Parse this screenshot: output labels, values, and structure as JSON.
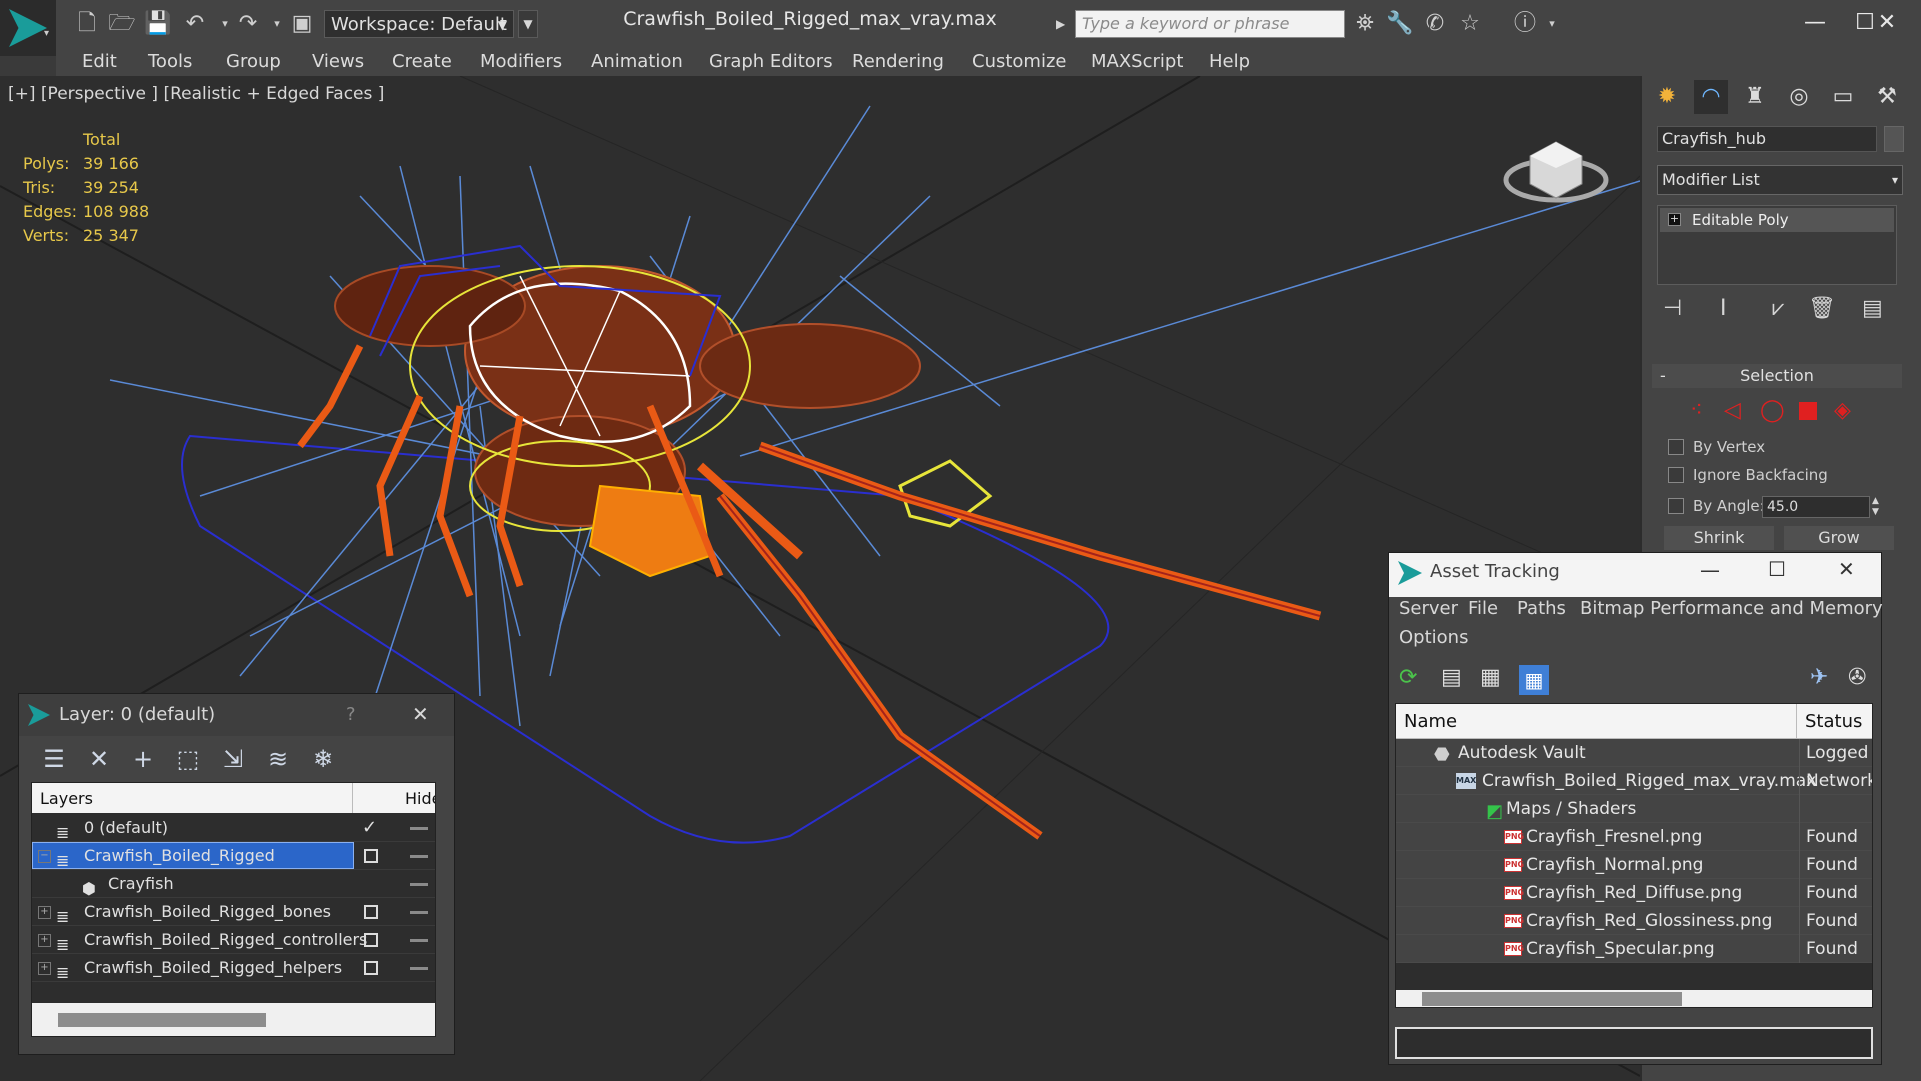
{
  "app": {
    "file_title": "Crawfish_Boiled_Rigged_max_vray.max",
    "workspace": "Workspace: Default",
    "search_placeholder": "Type a keyword or phrase"
  },
  "menu": [
    "Edit",
    "Tools",
    "Group",
    "Views",
    "Create",
    "Modifiers",
    "Animation",
    "Graph Editors",
    "Rendering",
    "Customize",
    "MAXScript",
    "Help"
  ],
  "viewport": {
    "label": "[+] [Perspective ] [Realistic + Edged Faces ]",
    "stats_header": "Total",
    "stats": [
      {
        "label": "Polys:",
        "value": "39 166"
      },
      {
        "label": "Tris:",
        "value": "39 254"
      },
      {
        "label": "Edges:",
        "value": "108 988"
      },
      {
        "label": "Verts:",
        "value": "25 347"
      }
    ]
  },
  "command_panel": {
    "object_name": "Crayfish_hub",
    "modifier_list": "Modifier List",
    "stack_item": "Editable Poly",
    "selection_title": "Selection",
    "selection_minus": "-",
    "by_vertex": "By Vertex",
    "ignore_backfacing": "Ignore Backfacing",
    "by_angle": "By Angle:",
    "angle_value": "45.0",
    "shrink": "Shrink",
    "grow": "Grow"
  },
  "layer_window": {
    "title": "Layer: 0 (default)",
    "help": "?",
    "close": "✕",
    "col_layers": "Layers",
    "col_hide": "Hide",
    "rows": [
      {
        "name": "0 (default)",
        "expander": "",
        "selected": false,
        "check": true
      },
      {
        "name": "Crawfish_Boiled_Rigged",
        "expander": "−",
        "selected": true,
        "check": false
      },
      {
        "name": "Crayfish",
        "expander": "",
        "selected": false,
        "check": false,
        "child": true
      },
      {
        "name": "Crawfish_Boiled_Rigged_bones",
        "expander": "+",
        "selected": false,
        "check": false
      },
      {
        "name": "Crawfish_Boiled_Rigged_controllers",
        "expander": "+",
        "selected": false,
        "check": false
      },
      {
        "name": "Crawfish_Boiled_Rigged_helpers",
        "expander": "+",
        "selected": false,
        "check": false
      }
    ]
  },
  "asset_window": {
    "title": "Asset Tracking",
    "menu1": [
      "Server",
      "File",
      "Paths",
      "Bitmap Performance and Memory"
    ],
    "menu2": [
      "Options"
    ],
    "col_name": "Name",
    "col_status": "Status",
    "rows": [
      {
        "name": "Autodesk Vault",
        "status": "Logged C",
        "indent": 1,
        "icon": "vault"
      },
      {
        "name": "Crawfish_Boiled_Rigged_max_vray.max",
        "status": "Network I",
        "indent": 2,
        "icon": "max"
      },
      {
        "name": "Maps / Shaders",
        "status": "",
        "indent": 3,
        "icon": "maps"
      },
      {
        "name": "Crayfish_Fresnel.png",
        "status": "Found",
        "indent": 4,
        "icon": "png"
      },
      {
        "name": "Crayfish_Normal.png",
        "status": "Found",
        "indent": 4,
        "icon": "png"
      },
      {
        "name": "Crayfish_Red_Diffuse.png",
        "status": "Found",
        "indent": 4,
        "icon": "png"
      },
      {
        "name": "Crayfish_Red_Glossiness.png",
        "status": "Found",
        "indent": 4,
        "icon": "png"
      },
      {
        "name": "Crayfish_Specular.png",
        "status": "Found",
        "indent": 4,
        "icon": "png"
      }
    ]
  }
}
